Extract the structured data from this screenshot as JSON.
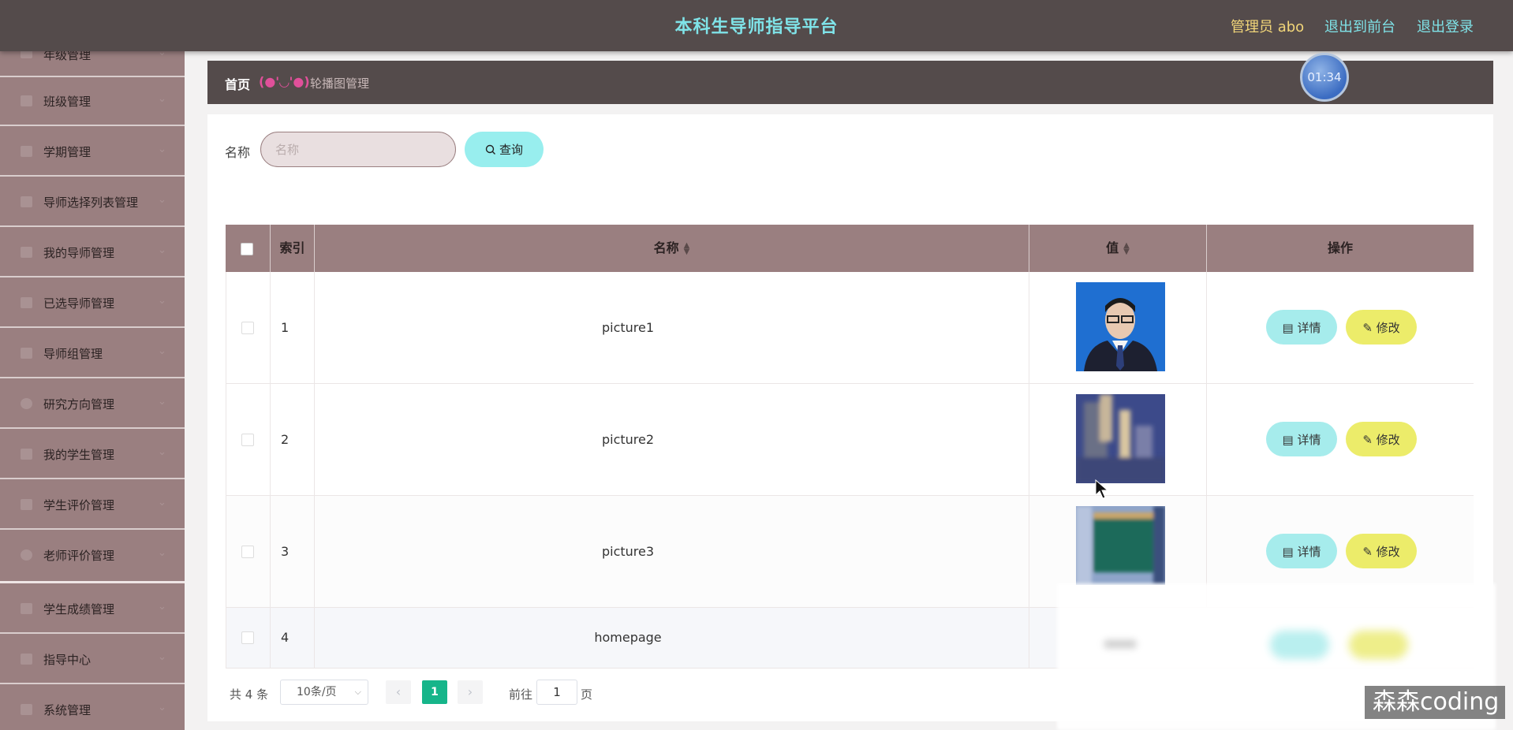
{
  "header": {
    "title": "本科生导师指导平台",
    "user": "管理员 abo",
    "links": [
      "退出到前台",
      "退出登录"
    ]
  },
  "sidebar": {
    "items": [
      {
        "label": "年级管理",
        "icon": "calendar-icon"
      },
      {
        "label": "班级管理",
        "icon": "flag-icon"
      },
      {
        "label": "学期管理",
        "icon": "monitor-icon"
      },
      {
        "label": "导师选择列表管理",
        "icon": "send-icon"
      },
      {
        "label": "我的导师管理",
        "icon": "user-icon"
      },
      {
        "label": "已选导师管理",
        "icon": "document-icon"
      },
      {
        "label": "导师组管理",
        "icon": "chart-icon"
      },
      {
        "label": "研究方向管理",
        "icon": "compass-icon"
      },
      {
        "label": "我的学生管理",
        "icon": "monitor-icon"
      },
      {
        "label": "学生评价管理",
        "icon": "send-icon"
      },
      {
        "label": "老师评价管理",
        "icon": "compass-icon"
      },
      {
        "label": "学生成绩管理",
        "icon": "list-icon"
      },
      {
        "label": "指导中心",
        "icon": "document-icon"
      },
      {
        "label": "系统管理",
        "icon": "monitor-icon"
      }
    ]
  },
  "breadcrumb": {
    "home": "首页",
    "face": "(●'◡'●)",
    "current": "轮播图管理"
  },
  "timer": "01:34",
  "search": {
    "label": "名称",
    "placeholder": "名称",
    "button": "查询"
  },
  "table": {
    "columns": [
      "索引",
      "名称",
      "值",
      "操作"
    ],
    "rows": [
      {
        "index": "1",
        "name": "picture1"
      },
      {
        "index": "2",
        "name": "picture2"
      },
      {
        "index": "3",
        "name": "picture3"
      },
      {
        "index": "4",
        "name": "homepage"
      }
    ],
    "detail_label": "详情",
    "edit_label": "修改"
  },
  "pagination": {
    "total": "共 4 条",
    "page_size": "10条/页",
    "current_page": "1",
    "goto_label": "前往",
    "goto_value": "1",
    "goto_suffix": "页"
  },
  "watermark": "森森coding"
}
